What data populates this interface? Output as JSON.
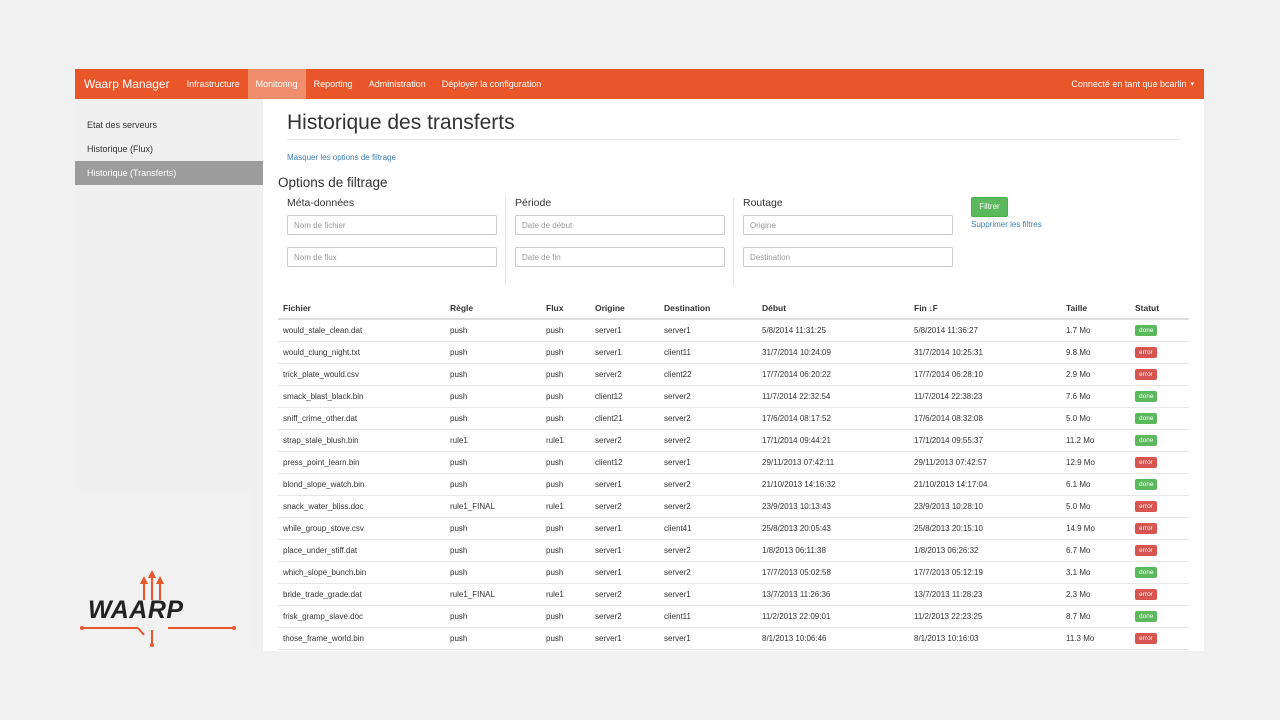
{
  "navbar": {
    "brand": "Waarp Manager",
    "items": [
      "Infrastructure",
      "Monitoring",
      "Reporting",
      "Administration",
      "Déployer la configuration"
    ],
    "active_index": 1,
    "user_label": "Connecté en tant que bcarlin",
    "user_caret": "▾",
    "color": "#e8562a"
  },
  "sidebar": {
    "items": [
      "Etat des serveurs",
      "Historique (Flux)",
      "Historique (Transferts)"
    ],
    "active_index": 2
  },
  "page": {
    "title": "Historique des transferts",
    "toggle_filters_link": "Masquer les options de filtrage"
  },
  "filters": {
    "title": "Options de filtrage",
    "metadata": {
      "label": "Méta-données",
      "filename_placeholder": "Nom de fichier",
      "flow_placeholder": "Nom de flux"
    },
    "period": {
      "label": "Période",
      "start_placeholder": "Date de début",
      "end_placeholder": "Date de fin"
    },
    "routing": {
      "label": "Routage",
      "origin_placeholder": "Origine",
      "destination_placeholder": "Destination"
    },
    "filter_button": "Filtrer",
    "clear_link": "Supprimer les filtres"
  },
  "table": {
    "columns": [
      "Fichier",
      "Règle",
      "Flux",
      "Origine",
      "Destination",
      "Début",
      "Fin",
      "Taille",
      "Statut"
    ],
    "sort_icon": "↓F",
    "rows": [
      [
        "would_stale_clean.dat",
        "push",
        "push",
        "server1",
        "server1",
        "5/8/2014 11:31:25",
        "5/8/2014 11:36:27",
        "1.7 Mo",
        "done"
      ],
      [
        "would_clung_night.txt",
        "push",
        "push",
        "server1",
        "client11",
        "31/7/2014 10:24:09",
        "31/7/2014 10:25:31",
        "9.8 Mo",
        "error"
      ],
      [
        "trick_plate_would.csv",
        "push",
        "push",
        "server2",
        "client22",
        "17/7/2014 06:20:22",
        "17/7/2014 06:28:10",
        "2.9 Mo",
        "error"
      ],
      [
        "smack_blast_black.bin",
        "push",
        "push",
        "client12",
        "server2",
        "11/7/2014 22:32:54",
        "11/7/2014 22:38:23",
        "7.6 Mo",
        "done"
      ],
      [
        "sniff_crime_other.dat",
        "push",
        "push",
        "client21",
        "server2",
        "17/6/2014 08:17:52",
        "17/6/2014 08:32:08",
        "5.0 Mo",
        "done"
      ],
      [
        "strap_stale_blush.bin",
        "rule1",
        "rule1",
        "server2",
        "server2",
        "17/1/2014 09:44:21",
        "17/1/2014 09:55:37",
        "11.2 Mo",
        "done"
      ],
      [
        "press_point_learn.bin",
        "push",
        "push",
        "client12",
        "server1",
        "29/11/2013 07:42:11",
        "29/11/2013 07:42:57",
        "12.9 Mo",
        "error"
      ],
      [
        "blond_slope_watch.bin",
        "push",
        "push",
        "server1",
        "server2",
        "21/10/2013 14:16:32",
        "21/10/2013 14:17:04",
        "6.1 Mo",
        "done"
      ],
      [
        "snack_water_bliss.doc",
        "rule1_FINAL",
        "rule1",
        "server2",
        "server2",
        "23/9/2013 10:13:43",
        "23/9/2013 10:28:10",
        "5.0 Mo",
        "error"
      ],
      [
        "while_group_stove.csv",
        "push",
        "push",
        "server1",
        "client41",
        "25/8/2013 20:05:43",
        "25/8/2013 20:15:10",
        "14.9 Mo",
        "error"
      ],
      [
        "place_under_stiff.dat",
        "push",
        "push",
        "server1",
        "server2",
        "1/8/2013 06:11:38",
        "1/8/2013 06:26:32",
        "6.7 Mo",
        "error"
      ],
      [
        "which_slope_bunch.bin",
        "push",
        "push",
        "server1",
        "server2",
        "17/7/2013 05:02:58",
        "17/7/2013 05:12:19",
        "3.1 Mo",
        "done"
      ],
      [
        "bride_trade_grade.dat",
        "rule1_FINAL",
        "rule1",
        "server2",
        "server1",
        "13/7/2013 11:26:36",
        "13/7/2013 11:28:23",
        "2.3 Mo",
        "error"
      ],
      [
        "frisk_gramp_slave.doc",
        "push",
        "push",
        "server2",
        "client11",
        "11/2/2013 22:09:01",
        "11/2/2013 22:23:25",
        "8.7 Mo",
        "done"
      ],
      [
        "those_frame_world.bin",
        "push",
        "push",
        "server1",
        "server1",
        "8/1/2013 10:06:46",
        "8/1/2013 10:16:03",
        "11.3 Mo",
        "error"
      ]
    ]
  },
  "logo": {
    "text": "WAARP",
    "color": "#e8562a"
  }
}
